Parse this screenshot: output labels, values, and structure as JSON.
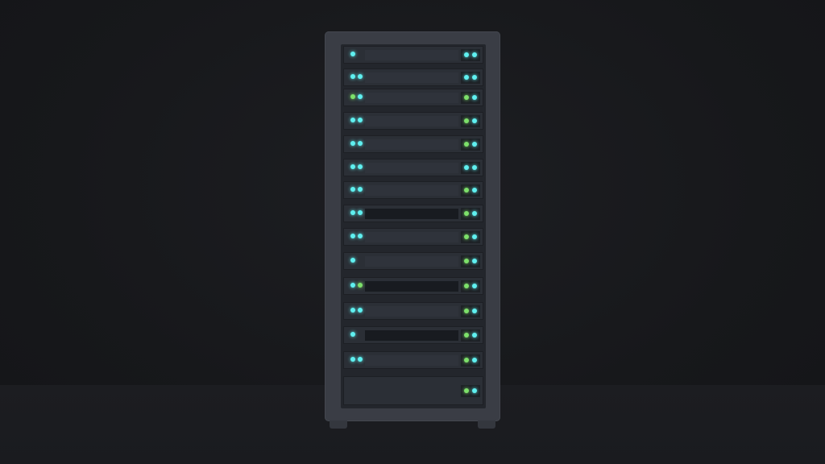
{
  "scene": {
    "background_color": "#17181c",
    "rack_color": "#3a3d45",
    "led_colors": {
      "cyan": "#5ff0f0",
      "green": "#7de06a"
    }
  },
  "rack": {
    "units": [
      {
        "left_leds": [
          "cyan"
        ],
        "right_leds": [
          "cyan",
          "cyan"
        ],
        "dark": false
      },
      {
        "left_leds": [
          "cyan",
          "cyan"
        ],
        "right_leds": [
          "cyan",
          "cyan"
        ],
        "dark": false
      },
      {
        "left_leds": [
          "green",
          "cyan"
        ],
        "right_leds": [
          "green",
          "cyan"
        ],
        "dark": false
      },
      {
        "left_leds": [
          "cyan",
          "cyan"
        ],
        "right_leds": [
          "green",
          "cyan"
        ],
        "dark": false
      },
      {
        "left_leds": [
          "cyan",
          "cyan"
        ],
        "right_leds": [
          "green",
          "cyan"
        ],
        "dark": false
      },
      {
        "left_leds": [
          "cyan",
          "cyan"
        ],
        "right_leds": [
          "cyan",
          "cyan"
        ],
        "dark": false
      },
      {
        "left_leds": [
          "cyan",
          "cyan"
        ],
        "right_leds": [
          "green",
          "cyan"
        ],
        "dark": false
      },
      {
        "left_leds": [
          "cyan",
          "cyan"
        ],
        "right_leds": [
          "green",
          "cyan"
        ],
        "dark": true
      },
      {
        "left_leds": [
          "cyan",
          "cyan"
        ],
        "right_leds": [
          "green",
          "cyan"
        ],
        "dark": false
      },
      {
        "left_leds": [
          "cyan"
        ],
        "right_leds": [
          "green",
          "cyan"
        ],
        "dark": false
      },
      {
        "left_leds": [
          "cyan",
          "green"
        ],
        "right_leds": [
          "green",
          "cyan"
        ],
        "dark": true
      },
      {
        "left_leds": [
          "cyan",
          "cyan"
        ],
        "right_leds": [
          "green",
          "cyan"
        ],
        "dark": false
      },
      {
        "left_leds": [
          "cyan"
        ],
        "right_leds": [
          "green",
          "cyan"
        ],
        "dark": true
      },
      {
        "left_leds": [
          "cyan",
          "cyan"
        ],
        "right_leds": [
          "green",
          "cyan"
        ],
        "dark": false
      },
      {
        "left_leds": [],
        "right_leds": [
          "green",
          "cyan"
        ],
        "dark": false,
        "big": true
      }
    ]
  }
}
